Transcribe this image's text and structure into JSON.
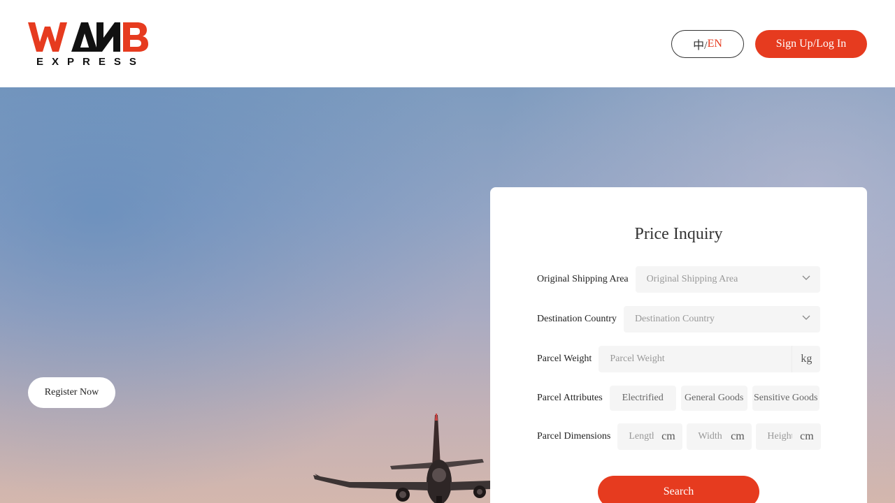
{
  "brand": {
    "logo_text": "WANB",
    "logo_subtext": "EXPRESS",
    "accent_color": "#e63b1f"
  },
  "header": {
    "lang_cn": "中/",
    "lang_en": "EN",
    "signup_label": "Sign Up/Log In"
  },
  "hero": {
    "register_label": "Register Now"
  },
  "inquiry": {
    "title": "Price Inquiry",
    "origin": {
      "label": "Original Shipping Area",
      "placeholder": "Original Shipping Area",
      "icon": "chevron-down-icon"
    },
    "destination": {
      "label": "Destination Country",
      "placeholder": "Destination Country",
      "icon": "chevron-down-icon"
    },
    "weight": {
      "label": "Parcel Weight",
      "placeholder": "Parcel Weight",
      "unit": "kg"
    },
    "attributes": {
      "label": "Parcel Attributes",
      "options": [
        "Electrified",
        "General Goods",
        "Sensitive Goods"
      ]
    },
    "dimensions": {
      "label": "Parcel Dimensions",
      "length_placeholder": "Length",
      "width_placeholder": "Width",
      "height_placeholder": "Height",
      "unit": "cm"
    },
    "search_label": "Search"
  }
}
